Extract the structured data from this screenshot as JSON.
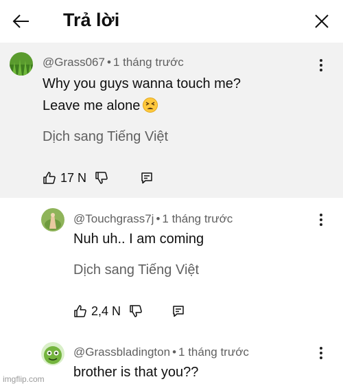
{
  "header": {
    "title": "Trả lời"
  },
  "comments": [
    {
      "author": "@Grass067",
      "time": "1 tháng trước",
      "lines": [
        "Why you guys wanna touch me?",
        "Leave me alone"
      ],
      "emoji": "tired-face",
      "translate": "Dịch sang Tiếng Việt",
      "likes": "17 N"
    },
    {
      "author": "@Touchgrass7j",
      "time": "1 tháng trước",
      "lines": [
        "Nuh uh.. I am coming"
      ],
      "translate": "Dịch sang Tiếng Việt",
      "likes": "2,4 N"
    },
    {
      "author": "@Grassbladington",
      "time": "1 tháng trước",
      "lines": [
        "brother is that you??"
      ]
    }
  ],
  "separator": "•",
  "watermark": "imgflip.com",
  "icons": {
    "back": "arrow-left-icon",
    "close": "close-icon",
    "more": "more-vert-icon",
    "like": "thumb-up-icon",
    "dislike": "thumb-down-icon",
    "reply": "reply-icon"
  },
  "colors": {
    "highlight_bg": "#f2f2f2",
    "meta_text": "#606060",
    "text": "#0f0f0f"
  }
}
